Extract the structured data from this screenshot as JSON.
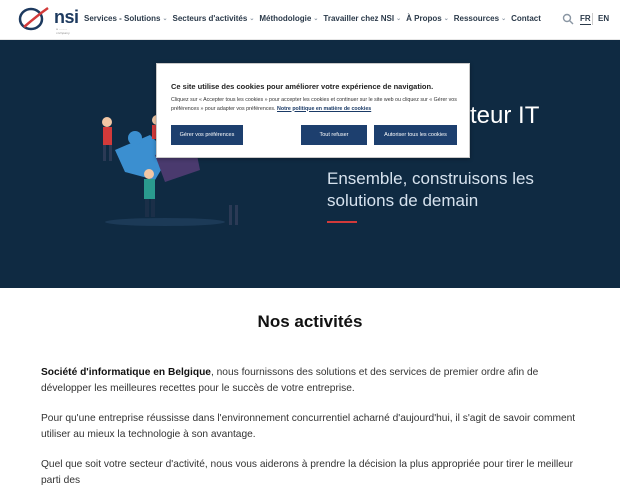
{
  "brand": {
    "logo_text": "nsi",
    "logo_sub": "a ......... company"
  },
  "nav": {
    "items": [
      {
        "label": "Services - Solutions",
        "has_dropdown": true
      },
      {
        "label": "Secteurs d'activités",
        "has_dropdown": true
      },
      {
        "label": "Méthodologie",
        "has_dropdown": true
      },
      {
        "label": "Travailler chez NSI",
        "has_dropdown": true
      },
      {
        "label": "À Propos",
        "has_dropdown": true
      },
      {
        "label": "Ressources",
        "has_dropdown": true
      },
      {
        "label": "Contact",
        "has_dropdown": false
      }
    ],
    "search_icon": "search-icon",
    "lang_fr": "FR",
    "lang_en": "EN",
    "active_lang": "FR"
  },
  "hero": {
    "title_fragment": "teur IT",
    "subtitle": "Ensemble, construisons les solutions de demain",
    "accent_color": "#d23a3a",
    "background": "#0f2a42"
  },
  "cookie_banner": {
    "title": "Ce site utilise des cookies pour améliorer votre expérience de navigation.",
    "text": "Cliquez sur « Accepter tous les cookies » pour accepter les cookies et continuer sur le site web ou cliquez sur « Gérer vos préférences » pour adapter vos préférences.",
    "policy_link": "Notre politique en matière de cookies",
    "btn_preferences": "Gérer vos préférences",
    "btn_refuse": "Tout refuser",
    "btn_allow": "Autoriser tous les cookies",
    "button_color": "#1d3f6e"
  },
  "main": {
    "section_title": "Nos activités",
    "p1_bold": "Société d'informatique en Belgique",
    "p1_rest": ", nous fournissons des solutions et des services  de premier ordre afin de développer les meilleures recettes pour le succès de votre entreprise.",
    "p2": "Pour qu'une entreprise réussisse dans l'environnement concurrentiel acharné d'aujourd'hui, il s'agit de savoir comment utiliser au mieux la technologie à son avantage.",
    "p3": "Quel que soit votre secteur d'activité, nous vous aiderons à prendre la décision la plus appropriée pour tirer le meilleur parti des"
  }
}
